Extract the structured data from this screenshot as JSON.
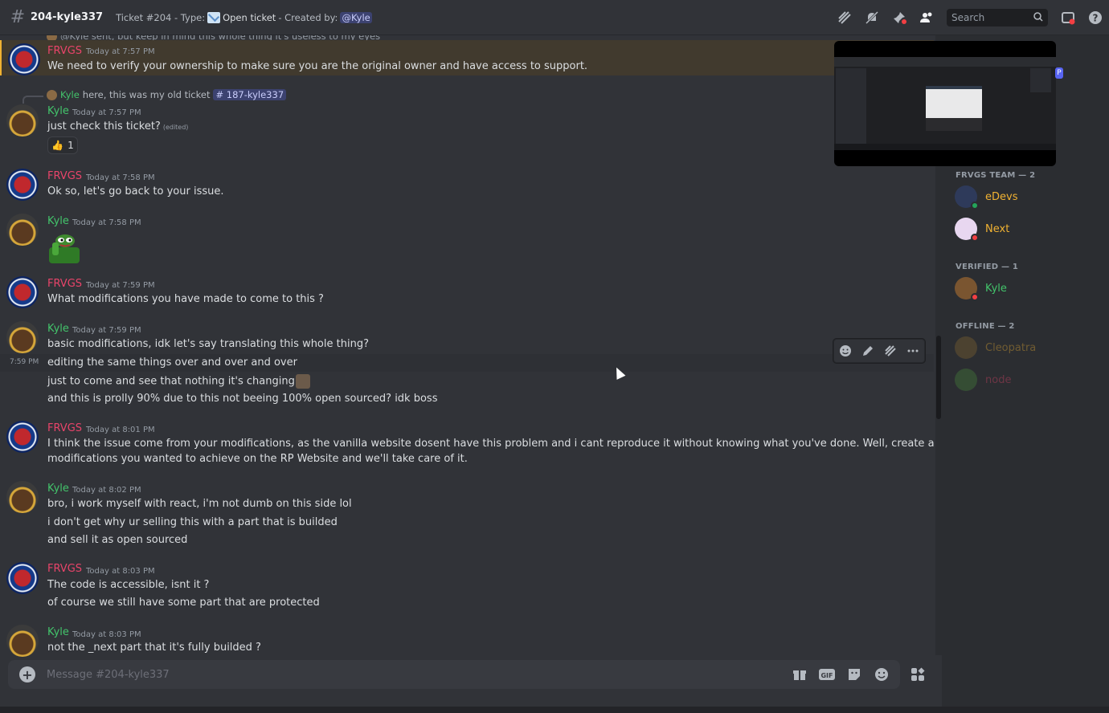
{
  "header": {
    "channel_name": "204-kyle337",
    "topic_prefix": "Ticket #204 - Type:",
    "topic_type": "Open ticket",
    "topic_created_by": "- Created by:",
    "topic_mention": "@Kyle",
    "search_placeholder": "Search",
    "icons": [
      "threads-icon",
      "mute-bell-icon",
      "pinned-icon",
      "members-icon",
      "inbox-icon",
      "help-icon"
    ]
  },
  "messages": {
    "top_reply_text": "@Kyle sent, but keep in mind this whole thing it's useless to my eyes",
    "m1": {
      "author": "FRVGS",
      "time": "Today at 7:57 PM",
      "text": "We need to verify your ownership to make sure you are the original owner and have access to support."
    },
    "m2": {
      "reply_author": "Kyle",
      "reply_text": "here, this was my old ticket",
      "reply_channel": "# 187-kyle337",
      "author": "Kyle",
      "time": "Today at 7:57 PM",
      "text": "just check this ticket?",
      "edited": "(edited)",
      "reaction_emoji": "👍",
      "reaction_count": "1"
    },
    "m3": {
      "author": "FRVGS",
      "time": "Today at 7:58 PM",
      "text": "Ok so, let's go back to your issue."
    },
    "m4": {
      "author": "Kyle",
      "time": "Today at 7:58 PM"
    },
    "m5": {
      "author": "FRVGS",
      "time": "Today at 7:59 PM",
      "text": "What modifications you have made to come to this ?"
    },
    "m6": {
      "author": "Kyle",
      "time": "Today at 7:59 PM",
      "side_time": "7:59 PM",
      "lines": [
        "basic modifications, idk let's say translating this whole thing?",
        "editing the same things over and over and over",
        "just to come and see that nothing it's changing",
        "and this is prolly 90% due to this not beeing 100% open sourced? idk boss"
      ]
    },
    "m7": {
      "author": "FRVGS",
      "time": "Today at 8:01 PM",
      "lines": [
        "I think the issue come from your modifications, as the vanilla website dosent have this problem and i cant reproduce it without knowing what you've done. Well, create a list of the",
        "modifications you wanted to achieve on the RP Website and we'll take care of it."
      ]
    },
    "m8": {
      "author": "Kyle",
      "time": "Today at 8:02 PM",
      "lines": [
        "bro, i work myself with react, i'm not dumb on this side lol",
        "i don't get why ur selling this with a part that is builded",
        "and sell it as open sourced"
      ]
    },
    "m9": {
      "author": "FRVGS",
      "time": "Today at 8:03 PM",
      "lines": [
        "The code is accessible, isnt it ?",
        "of course we still have some part that are protected"
      ]
    },
    "m10": {
      "author": "Kyle",
      "time": "Today at 8:03 PM",
      "text": "not the _next part that it's fully builded ?"
    }
  },
  "composer": {
    "placeholder": "Message #204-kyle337"
  },
  "members": {
    "team_header": "FRVGS TEAM — 2",
    "verified_header": "VERIFIED — 1",
    "offline_header": "OFFLINE — 2",
    "team": [
      {
        "name": "eDevs",
        "status_color": "#23a55a"
      },
      {
        "name": "Next",
        "status_color": "#f23f43"
      }
    ],
    "verified": [
      {
        "name": "Kyle",
        "status_color": "#f23f43"
      }
    ],
    "offline": [
      {
        "name": "Cleopatra"
      },
      {
        "name": "node"
      }
    ]
  },
  "preview_tag": "P",
  "colors": {
    "frvgs": "#e9446a",
    "kyle": "#43c46b",
    "gold": "#f0b232",
    "node": "#e9446a"
  }
}
